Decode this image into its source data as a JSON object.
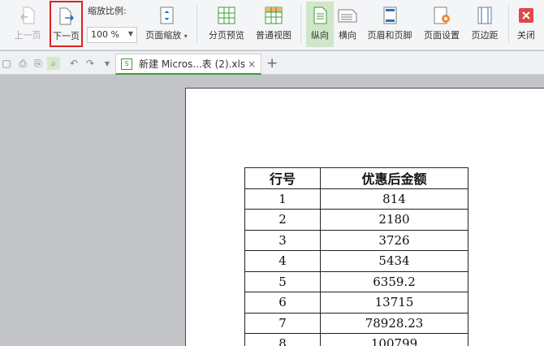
{
  "toolbar": {
    "prev_page": "上一页",
    "next_page": "下一页",
    "zoom_label": "缩放比例:",
    "zoom_value": "100 %",
    "page_zoom": "页面缩放",
    "page_break_preview": "分页预览",
    "normal_view": "普通视图",
    "portrait": "纵向",
    "landscape": "横向",
    "header_footer": "页眉和页脚",
    "page_setup": "页面设置",
    "margins": "页边距",
    "close": "关闭"
  },
  "tabs": {
    "doc_name": "新建 Micros...表 (2).xls",
    "close_glyph": "×",
    "add_glyph": "+"
  },
  "table": {
    "headers": [
      "行号",
      "优惠后金额"
    ],
    "rows": [
      [
        "1",
        "814"
      ],
      [
        "2",
        "2180"
      ],
      [
        "3",
        "3726"
      ],
      [
        "4",
        "5434"
      ],
      [
        "5",
        "6359.2"
      ],
      [
        "6",
        "13715"
      ],
      [
        "7",
        "78928.23"
      ],
      [
        "8",
        "100799"
      ]
    ]
  },
  "colors": {
    "highlight": "#e02020",
    "active_bg": "#cfe6c8",
    "accent_green": "#3c9a3c",
    "close_red": "#e04848"
  }
}
